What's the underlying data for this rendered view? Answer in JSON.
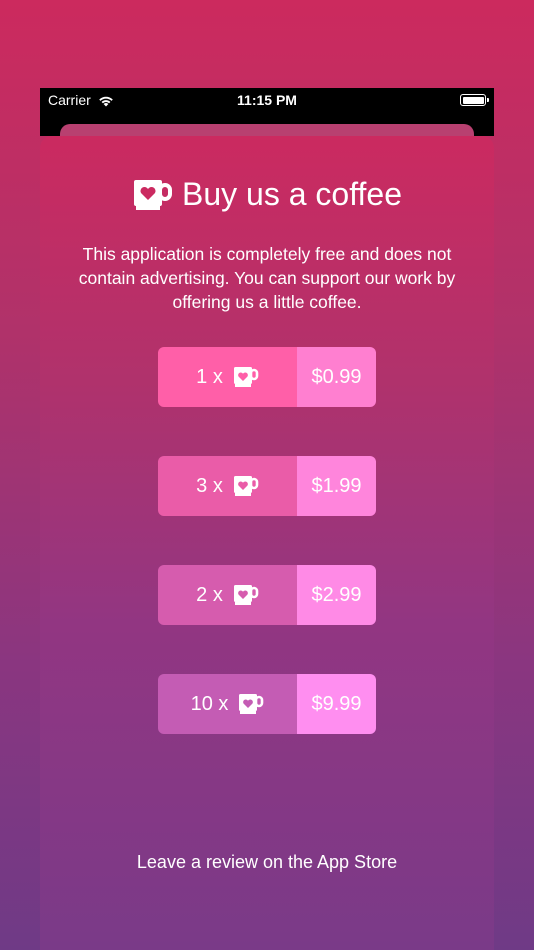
{
  "status_bar": {
    "carrier": "Carrier",
    "time": "11:15 PM"
  },
  "sheet": {
    "title": "Buy us a coffee",
    "description": "This application is completely free and does not contain advertising. You can support our work by offering us a little coffee.",
    "icon": "coffee-heart-icon"
  },
  "options": [
    {
      "qty": "1 x",
      "price": "$0.99",
      "qty_color": "#ff5fa8",
      "price_color": "#ff7fd0"
    },
    {
      "qty": "3 x",
      "price": "$1.99",
      "qty_color": "#ea5ca8",
      "price_color": "#ff85dc"
    },
    {
      "qty": "2 x",
      "price": "$2.99",
      "qty_color": "#d65cae",
      "price_color": "#ff8ae6"
    },
    {
      "qty": "10 x",
      "price": "$9.99",
      "qty_color": "#c45cb4",
      "price_color": "#ff8ef0"
    }
  ],
  "footer": {
    "review_link": "Leave a review on the App Store"
  }
}
